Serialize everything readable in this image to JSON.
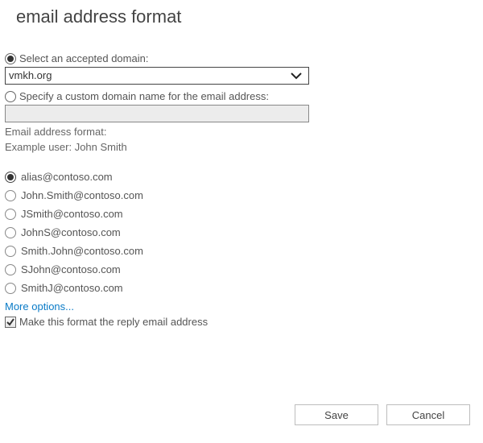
{
  "title": "email address format",
  "domain_select": {
    "radio_label": "Select an accepted domain:",
    "value": "vmkh.org",
    "selected": true
  },
  "custom_domain": {
    "radio_label": "Specify a custom domain name for the email address:",
    "value": "",
    "selected": false
  },
  "format_heading": "Email address format:",
  "example_text": "Example user: John Smith",
  "formats": [
    {
      "label": "alias@contoso.com",
      "selected": true,
      "highlight": false
    },
    {
      "label": "John.Smith@contoso.com",
      "selected": false,
      "highlight": true
    },
    {
      "label": "JSmith@contoso.com",
      "selected": false,
      "highlight": false
    },
    {
      "label": "JohnS@contoso.com",
      "selected": false,
      "highlight": false
    },
    {
      "label": "Smith.John@contoso.com",
      "selected": false,
      "highlight": false
    },
    {
      "label": "SJohn@contoso.com",
      "selected": false,
      "highlight": false
    },
    {
      "label": "SmithJ@contoso.com",
      "selected": false,
      "highlight": false
    }
  ],
  "more_options": "More options...",
  "reply_checkbox": {
    "label": "Make this format the reply email address",
    "checked": true
  },
  "buttons": {
    "save": "Save",
    "cancel": "Cancel"
  }
}
